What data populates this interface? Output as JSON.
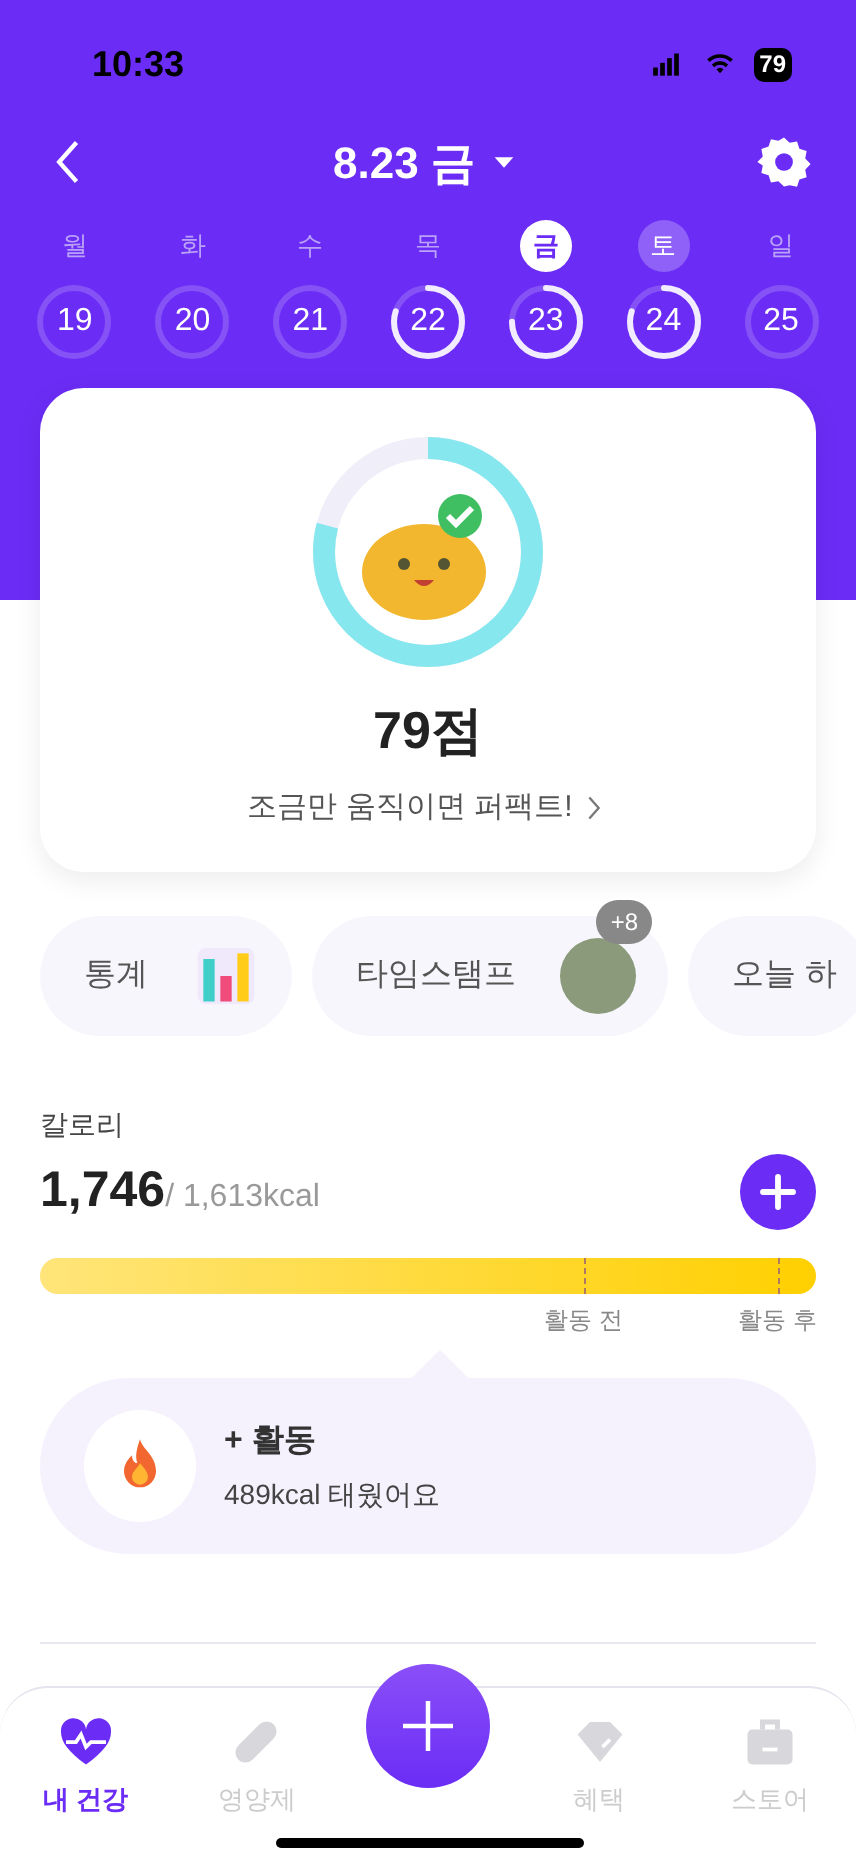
{
  "status_bar": {
    "time": "10:33",
    "battery": "79"
  },
  "header": {
    "title": "8.23 금"
  },
  "week": [
    {
      "weekday": "월",
      "date": "19",
      "selected": false,
      "today": false,
      "level": 0
    },
    {
      "weekday": "화",
      "date": "20",
      "selected": false,
      "today": false,
      "level": 0
    },
    {
      "weekday": "수",
      "date": "21",
      "selected": false,
      "today": false,
      "level": 0
    },
    {
      "weekday": "목",
      "date": "22",
      "selected": false,
      "today": false,
      "level": 0.8
    },
    {
      "weekday": "금",
      "date": "23",
      "selected": true,
      "today": false,
      "level": 0.75
    },
    {
      "weekday": "토",
      "date": "24",
      "selected": false,
      "today": true,
      "level": 0.8
    },
    {
      "weekday": "일",
      "date": "25",
      "selected": false,
      "today": false,
      "level": 0
    }
  ],
  "score": {
    "level": 0.79,
    "value": "79점",
    "message": "조금만 움직이면 퍼팩트!"
  },
  "shortcuts": [
    {
      "kind": "chart",
      "label": "통계"
    },
    {
      "kind": "photo",
      "label": "타임스탬프",
      "badge": "+8"
    },
    {
      "kind": "plain",
      "label": "오늘 하"
    }
  ],
  "calorie": {
    "title": "칼로리",
    "value": "1,746",
    "target": "/ 1,613kcal",
    "level": 1,
    "markers": [
      {
        "label": "활동 전",
        "level": 0.7
      },
      {
        "label": "활동 후",
        "level": 0.95
      }
    ],
    "activity": {
      "title": "+ 활동",
      "detail": "489kcal 태웠어요"
    }
  },
  "nav": [
    {
      "kind": "heart",
      "label": "내 건강",
      "selected": true
    },
    {
      "kind": "pill",
      "label": "영양제",
      "selected": false
    },
    {
      "kind": "add"
    },
    {
      "kind": "tag",
      "label": "혜택",
      "selected": false
    },
    {
      "kind": "bag",
      "label": "스토어",
      "selected": false
    }
  ]
}
